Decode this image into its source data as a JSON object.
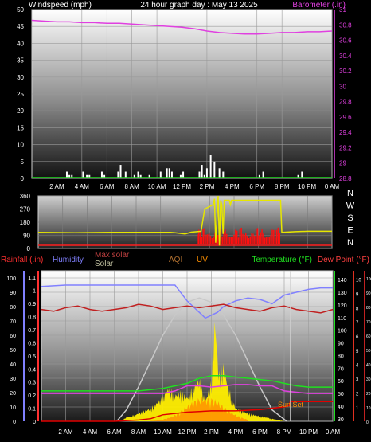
{
  "colors": {
    "wind": "#ffffff",
    "barometer": "#e040e0",
    "direction": "#e6e600",
    "solar_bars": "#ff1010",
    "rain_axis": "#ff3030",
    "humidity": "#8080ff",
    "solar": "#ffee00",
    "max_solar": "#c8c8c8",
    "uv": "#ff9000",
    "temperature": "#20e020",
    "dewpoint": "#c02020",
    "aqi": "#b07030"
  },
  "chart_data": [
    {
      "type": "line",
      "id": "wind_barometer",
      "title": "24 hour graph day : May 13 2025",
      "ylabel": "Windspeed (mph)",
      "ylabel_right": "Barometer (.in)",
      "x_tick_labels": [
        "2 AM",
        "4 AM",
        "6 AM",
        "8 AM",
        "10 AM",
        "12 PM",
        "2 PM",
        "4 PM",
        "6 PM",
        "8 PM",
        "10 PM",
        "0 AM"
      ],
      "ylim": [
        0,
        50
      ],
      "yticks": [
        "0",
        "5",
        "10",
        "15",
        "20",
        "25",
        "30",
        "35",
        "40",
        "45",
        "50"
      ],
      "y2lim": [
        28.8,
        31.0
      ],
      "y2ticks": [
        "28.8",
        "29",
        "29.2",
        "29.4",
        "29.6",
        "29.8",
        "30",
        "30.2",
        "30.4",
        "30.6",
        "30.8",
        "31"
      ],
      "series": [
        {
          "key": "barometer",
          "axis": "right",
          "x": [
            0,
            1,
            2,
            3,
            4,
            5,
            6,
            7,
            8,
            9,
            10,
            11,
            12,
            13,
            14,
            15,
            16,
            17,
            18,
            19,
            20,
            21,
            22,
            23,
            24
          ],
          "values": [
            30.86,
            30.85,
            30.84,
            30.84,
            30.83,
            30.83,
            30.82,
            30.82,
            30.81,
            30.8,
            30.79,
            30.78,
            30.77,
            30.75,
            30.72,
            30.7,
            30.69,
            30.68,
            30.68,
            30.69,
            30.7,
            30.7,
            30.71,
            30.71,
            30.72
          ]
        },
        {
          "key": "wind_gust",
          "axis": "left",
          "x": [
            2.8,
            3.0,
            3.2,
            4.1,
            4.4,
            4.6,
            5.6,
            5.8,
            6.9,
            7.1,
            7.5,
            8.2,
            8.5,
            8.7,
            9.4,
            10.3,
            10.8,
            11.0,
            11.2,
            11.9,
            12.1,
            13.4,
            13.6,
            13.8,
            14.0,
            14.3,
            14.6,
            15.0,
            15.3,
            18.2,
            18.5,
            21.3,
            21.6
          ],
          "values": [
            2,
            1,
            1,
            2,
            1,
            1,
            2,
            1,
            2,
            4,
            2,
            1,
            2,
            1,
            1,
            2,
            3,
            3,
            2,
            1,
            2,
            2,
            4,
            1,
            3,
            7,
            5,
            3,
            2,
            1,
            2,
            1,
            2
          ]
        }
      ]
    },
    {
      "type": "line",
      "id": "direction_solar",
      "ylim": [
        0,
        360
      ],
      "yticks": [
        "0",
        "90",
        "180",
        "270",
        "360"
      ],
      "right_labels": [
        "N",
        "W",
        "S",
        "E",
        "N"
      ],
      "series": [
        {
          "key": "wind_direction",
          "x": [
            0,
            3,
            6,
            9,
            10,
            10.8,
            11.2,
            12,
            12.5,
            13.3,
            13.6,
            14.3,
            14.4,
            14.5,
            14.7,
            14.8,
            14.9,
            15.0,
            15.1,
            15.2,
            15.6,
            15.7,
            15.8,
            19.8,
            19.9,
            21,
            22,
            23,
            24
          ],
          "values": [
            110,
            108,
            110,
            110,
            110,
            110,
            108,
            100,
            112,
            118,
            270,
            300,
            340,
            40,
            360,
            20,
            330,
            300,
            100,
            330,
            330,
            300,
            330,
            330,
            110,
            115,
            118,
            118,
            118
          ]
        }
      ]
    },
    {
      "type": "line",
      "id": "weather_main",
      "legend": [
        "Rainfall (.in)",
        "Humidity",
        "Max solar",
        "Solar",
        "AQI",
        "UV",
        "Temperature (°F)",
        "Dew Point (°F)"
      ],
      "y_rain_ticks": [
        "0",
        "0.1",
        "0.2",
        "0.3",
        "0.4",
        "0.5",
        "0.6",
        "0.7",
        "0.8",
        "0.9",
        "1",
        "1.1"
      ],
      "y_hum_ticks": [
        "0",
        "10",
        "20",
        "30",
        "40",
        "50",
        "60",
        "70",
        "80",
        "90",
        "100"
      ],
      "y_temp_ticks": [
        "30",
        "40",
        "50",
        "60",
        "70",
        "80",
        "90",
        "100",
        "110",
        "120",
        "130",
        "140"
      ],
      "y_uv_ticks": [
        "1",
        "2",
        "3",
        "4",
        "5",
        "6",
        "7",
        "8",
        "9",
        "10"
      ],
      "y_dew_ticks": [
        "0",
        "10",
        "20",
        "30",
        "40",
        "50",
        "60",
        "70",
        "80",
        "90",
        "100"
      ],
      "annotation": "Sun Set",
      "series": [
        {
          "key": "humidity",
          "unit": "%",
          "x": [
            0,
            2,
            4,
            6,
            8,
            10,
            11,
            12,
            12.5,
            13,
            13.5,
            14,
            14.5,
            15,
            16,
            17,
            18,
            19,
            20,
            21,
            22,
            23,
            24
          ],
          "values": [
            94,
            95,
            95,
            95,
            95,
            95,
            95,
            84,
            80,
            76,
            72,
            74,
            76,
            80,
            84,
            86,
            85,
            82,
            88,
            90,
            92,
            93,
            93
          ]
        },
        {
          "key": "temperature",
          "unit": "F",
          "x": [
            0,
            2,
            4,
            6,
            8,
            10,
            12,
            13,
            14,
            15,
            16,
            17,
            18,
            19,
            20,
            21,
            22,
            23,
            24
          ],
          "values": [
            52,
            52,
            52,
            52,
            52,
            54,
            58,
            62,
            64,
            64,
            63,
            62,
            61,
            60,
            58,
            56,
            55,
            55,
            55
          ]
        },
        {
          "key": "dewpoint",
          "unit": "F",
          "x": [
            0,
            1,
            2,
            3,
            4,
            5,
            6,
            7,
            8,
            9,
            10,
            11,
            12,
            13,
            14,
            15,
            16,
            17,
            18,
            19,
            20,
            21,
            22,
            23,
            24
          ],
          "values": [
            52,
            51,
            53,
            54,
            52,
            51,
            52,
            53,
            55,
            54,
            52,
            53,
            54,
            53,
            54,
            55,
            53,
            52,
            51,
            53,
            54,
            52,
            51,
            50,
            52
          ]
        },
        {
          "key": "temp_low",
          "unit": "F",
          "x": [
            0,
            2,
            4,
            6,
            8,
            10,
            11,
            12,
            13,
            14,
            15,
            16,
            17,
            18,
            19,
            20,
            21,
            22,
            23,
            24
          ],
          "values": [
            50,
            50,
            50,
            50,
            50,
            50,
            52,
            56,
            56,
            55,
            56,
            57,
            57,
            56,
            56,
            52,
            51,
            50,
            50,
            50
          ]
        },
        {
          "key": "max_solar",
          "unit": "W/m2",
          "x": [
            6.2,
            7,
            8,
            9,
            10,
            11,
            12,
            13,
            14,
            15,
            16,
            17,
            18,
            19,
            20.2
          ],
          "values": [
            0,
            80,
            240,
            420,
            600,
            740,
            830,
            860,
            830,
            740,
            600,
            420,
            240,
            80,
            0
          ]
        },
        {
          "key": "rain",
          "unit": "in",
          "x": [
            0,
            6,
            8,
            9,
            10,
            12,
            14,
            16,
            18,
            19,
            20,
            20.4,
            20.5,
            24
          ],
          "values": [
            0,
            0,
            0.01,
            0.02,
            0.05,
            0.07,
            0.08,
            0.08,
            0.09,
            0.1,
            0.11,
            0.12,
            0.15,
            0.15
          ]
        },
        {
          "key": "solar",
          "unit": "W/m2",
          "x": [
            6.5,
            7,
            8,
            9,
            10,
            10.5,
            11,
            11.5,
            12,
            12.5,
            13,
            13.5,
            14,
            14.3,
            14.6,
            15,
            15.3,
            15.6,
            16,
            17,
            18,
            19,
            20
          ],
          "values": [
            0,
            30,
            60,
            100,
            180,
            260,
            200,
            220,
            180,
            260,
            320,
            150,
            300,
            800,
            350,
            420,
            300,
            200,
            100,
            60,
            40,
            20,
            0
          ]
        }
      ]
    }
  ]
}
